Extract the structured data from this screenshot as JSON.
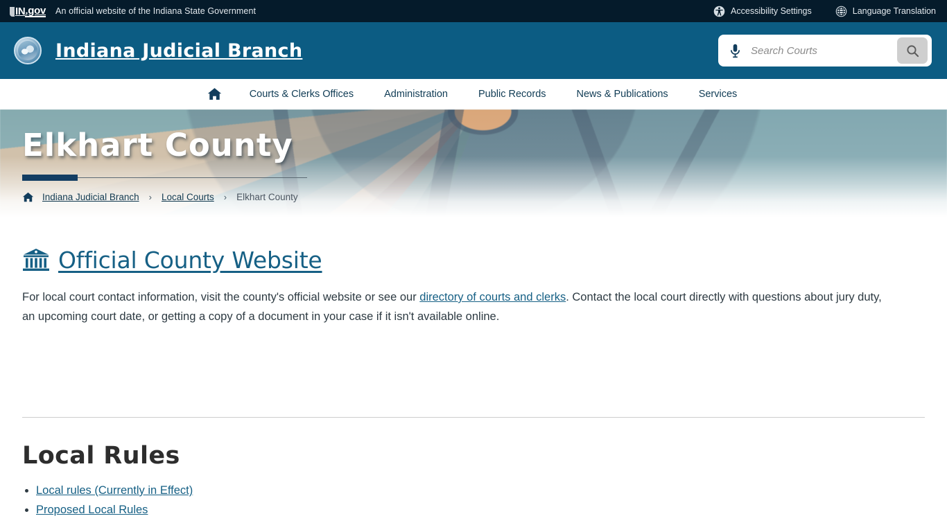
{
  "utility_bar": {
    "logo_in": "IN",
    "logo_gov": ".gov",
    "tagline": "An official website of the Indiana State Government",
    "links": [
      {
        "label": "Accessibility Settings",
        "icon": "accessibility-icon"
      },
      {
        "label": "Language Translation",
        "icon": "globe-icon"
      }
    ]
  },
  "header": {
    "title": "Indiana Judicial Branch",
    "seal_icon": "state-seal-icon",
    "search": {
      "placeholder": "Search Courts",
      "value": "",
      "mic_icon": "microphone-icon",
      "search_icon": "search-icon"
    }
  },
  "nav": {
    "home_icon": "home-icon",
    "items": [
      {
        "label": "Courts & Clerks Offices"
      },
      {
        "label": "Administration"
      },
      {
        "label": "Public Records"
      },
      {
        "label": "News & Publications"
      },
      {
        "label": "Services"
      }
    ]
  },
  "hero": {
    "title": "Elkhart County",
    "background_image": "stained-glass-dome-photo"
  },
  "breadcrumb": {
    "home_icon": "home-icon",
    "separator": "›",
    "items": [
      {
        "label": "Indiana Judicial Branch",
        "current": false
      },
      {
        "label": "Local Courts",
        "current": false
      },
      {
        "label": "Elkhart County",
        "current": true
      }
    ]
  },
  "main": {
    "county_website": {
      "icon": "courthouse-icon",
      "label": "Official County Website"
    },
    "paragraph": {
      "part1": "For local court contact information, visit the county's official website or see our ",
      "link": "directory of courts and clerks",
      "part2": ". Contact the local court directly with questions about jury duty, an upcoming court date, or getting a copy of a document in your case if it isn't available online."
    },
    "local_rules": {
      "heading": "Local Rules",
      "links": [
        {
          "label": "Local rules (Currently in Effect)"
        },
        {
          "label": "Proposed Local Rules"
        }
      ]
    }
  },
  "colors": {
    "utility_bar_bg": "#051b2b",
    "header_bg": "#0c5c83",
    "link_blue": "#166085",
    "accent_navy": "#123d63",
    "body_text": "#2d3a42"
  }
}
